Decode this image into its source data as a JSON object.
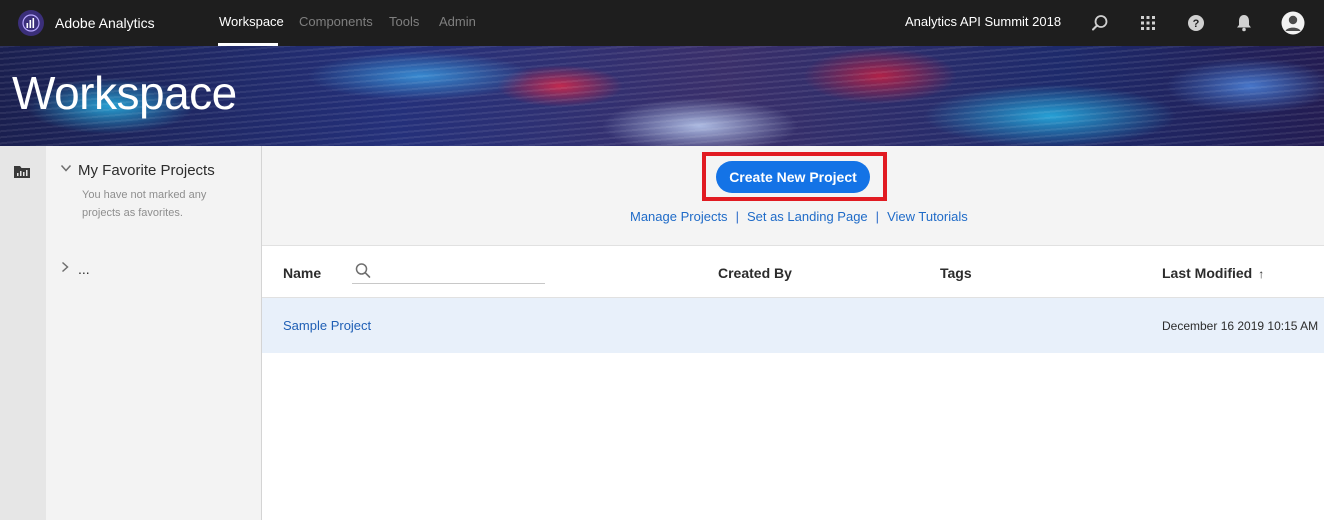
{
  "app": {
    "name": "Adobe Analytics"
  },
  "nav": {
    "items": [
      {
        "label": "Workspace",
        "active": true
      },
      {
        "label": "Components",
        "active": false
      },
      {
        "label": "Tools",
        "active": false
      },
      {
        "label": "Admin",
        "active": false
      }
    ],
    "org": "Analytics API Summit 2018",
    "icons": [
      "search-icon",
      "app-grid-icon",
      "help-icon",
      "notifications-icon",
      "user-avatar-icon"
    ]
  },
  "banner": {
    "title": "Workspace"
  },
  "favorites": {
    "title": "My Favorite Projects",
    "empty_text": "You have not marked any projects as favorites.",
    "more_label": "..."
  },
  "actions": {
    "create_label": "Create New Project",
    "links": [
      "Manage Projects",
      "Set as Landing Page",
      "View Tutorials"
    ],
    "separator": "|"
  },
  "table": {
    "columns": {
      "name": "Name",
      "created_by": "Created By",
      "tags": "Tags",
      "last_modified": "Last Modified",
      "sort_indicator": "↑"
    },
    "search_value": "",
    "rows": [
      {
        "name": "Sample Project",
        "created_by": "",
        "tags": "",
        "last_modified": "December 16 2019 10:15 AM"
      }
    ]
  },
  "colors": {
    "accent": "#1473e6",
    "highlight_border": "#e11b22",
    "link": "#1f6bc8",
    "nav_bg": "#1e1e1e",
    "row_selected": "#e8f0fa"
  }
}
